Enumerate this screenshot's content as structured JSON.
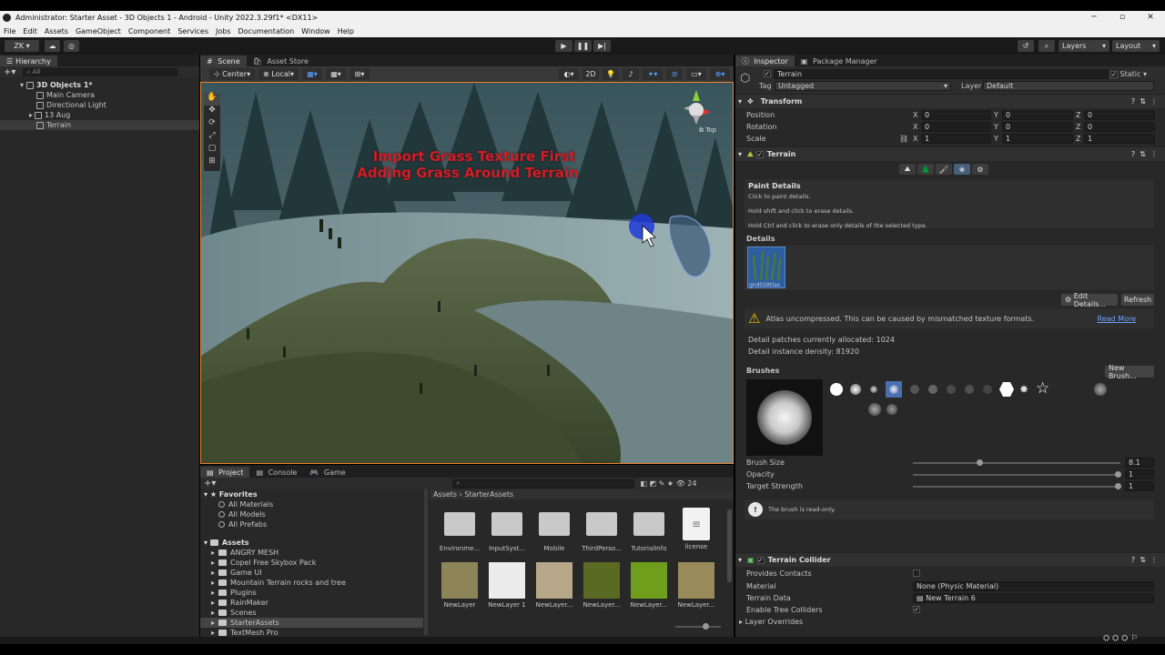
{
  "window": {
    "title": "Administrator: Starter Asset - 3D Objects 1 - Android - Unity 2022.3.29f1* <DX11>"
  },
  "menu": [
    "File",
    "Edit",
    "Assets",
    "GameObject",
    "Component",
    "Services",
    "Jobs",
    "Documentation",
    "Window",
    "Help"
  ],
  "toolbar": {
    "account": "ZK",
    "layers": "Layers",
    "layout": "Layout"
  },
  "hierarchy": {
    "tab": "Hierarchy",
    "search": "All",
    "scene": "3D Objects 1*",
    "items": [
      "Main Camera",
      "Directional Light",
      "13 Aug",
      "Terrain"
    ]
  },
  "scene": {
    "tabs": [
      "Scene",
      "Asset Store"
    ],
    "pivot": "Center",
    "space": "Local",
    "mode2d": "2D",
    "gizmo_label": "Top",
    "overlay_line1": "Import Grass Texture First",
    "overlay_line2": "Adding Grass Around Terrain",
    "overlay_color": "#d01e28"
  },
  "project": {
    "tabs": [
      "Project",
      "Console",
      "Game"
    ],
    "favorites_label": "Favorites",
    "favorites": [
      "All Materials",
      "All Models",
      "All Prefabs"
    ],
    "assets_label": "Assets",
    "assets": [
      "ANGRY MESH",
      "Copel Free Skybox Pack",
      "Game UI",
      "Mountain Terrain rocks and tree",
      "Plugins",
      "RainMaker",
      "Scenes",
      "StarterAssets",
      "TextMesh Pro"
    ],
    "breadcrumb": [
      "Assets",
      "StarterAssets"
    ],
    "count": "24",
    "folders": [
      "Environme...",
      "InputSyst...",
      "Mobile",
      "ThirdPerso...",
      "TutorialInfo"
    ],
    "license": "license",
    "layers": [
      "NewLayer",
      "NewLayer 1",
      "NewLayer...",
      "NewLayer...",
      "NewLayer...",
      "NewLayer..."
    ]
  },
  "inspector": {
    "tabs": [
      "Inspector",
      "Package Manager"
    ],
    "object_name": "Terrain",
    "static": "Static",
    "tag_label": "Tag",
    "tag": "Untagged",
    "layer_label": "Layer",
    "layer": "Default",
    "transform": {
      "title": "Transform",
      "rows": [
        {
          "label": "Position",
          "x": "0",
          "y": "0",
          "z": "0"
        },
        {
          "label": "Rotation",
          "x": "0",
          "y": "0",
          "z": "0"
        },
        {
          "label": "Scale",
          "x": "1",
          "y": "1",
          "z": "1"
        }
      ]
    },
    "terrain": {
      "title": "Terrain",
      "paint_title": "Paint Details",
      "help1": "Click to paint details.",
      "help2": "Hold shift and click to erase details.",
      "help3": "Hold Ctrl and click to erase only details of the selected type.",
      "details_label": "Details",
      "detail_item": "gnd02Atlas",
      "edit_details": "Edit Details...",
      "refresh": "Refresh",
      "warning": "Atlas uncompressed. This can be caused by mismatched texture formats.",
      "read_more": "Read More",
      "patches": "Detail patches currently allocated: 1024",
      "density": "Detail instance density: 81920",
      "brushes_label": "Brushes",
      "new_brush": "New Brush...",
      "brush_size_label": "Brush Size",
      "brush_size": "8.1",
      "opacity_label": "Opacity",
      "opacity": "1",
      "strength_label": "Target Strength",
      "strength": "1",
      "readonly": "The brush is read-only."
    },
    "collider": {
      "title": "Terrain Collider",
      "provides": "Provides Contacts",
      "material_label": "Material",
      "material": "None (Physic Material)",
      "data_label": "Terrain Data",
      "data": "New Terrain 6",
      "trees_label": "Enable Tree Colliders",
      "overrides": "Layer Overrides"
    }
  }
}
